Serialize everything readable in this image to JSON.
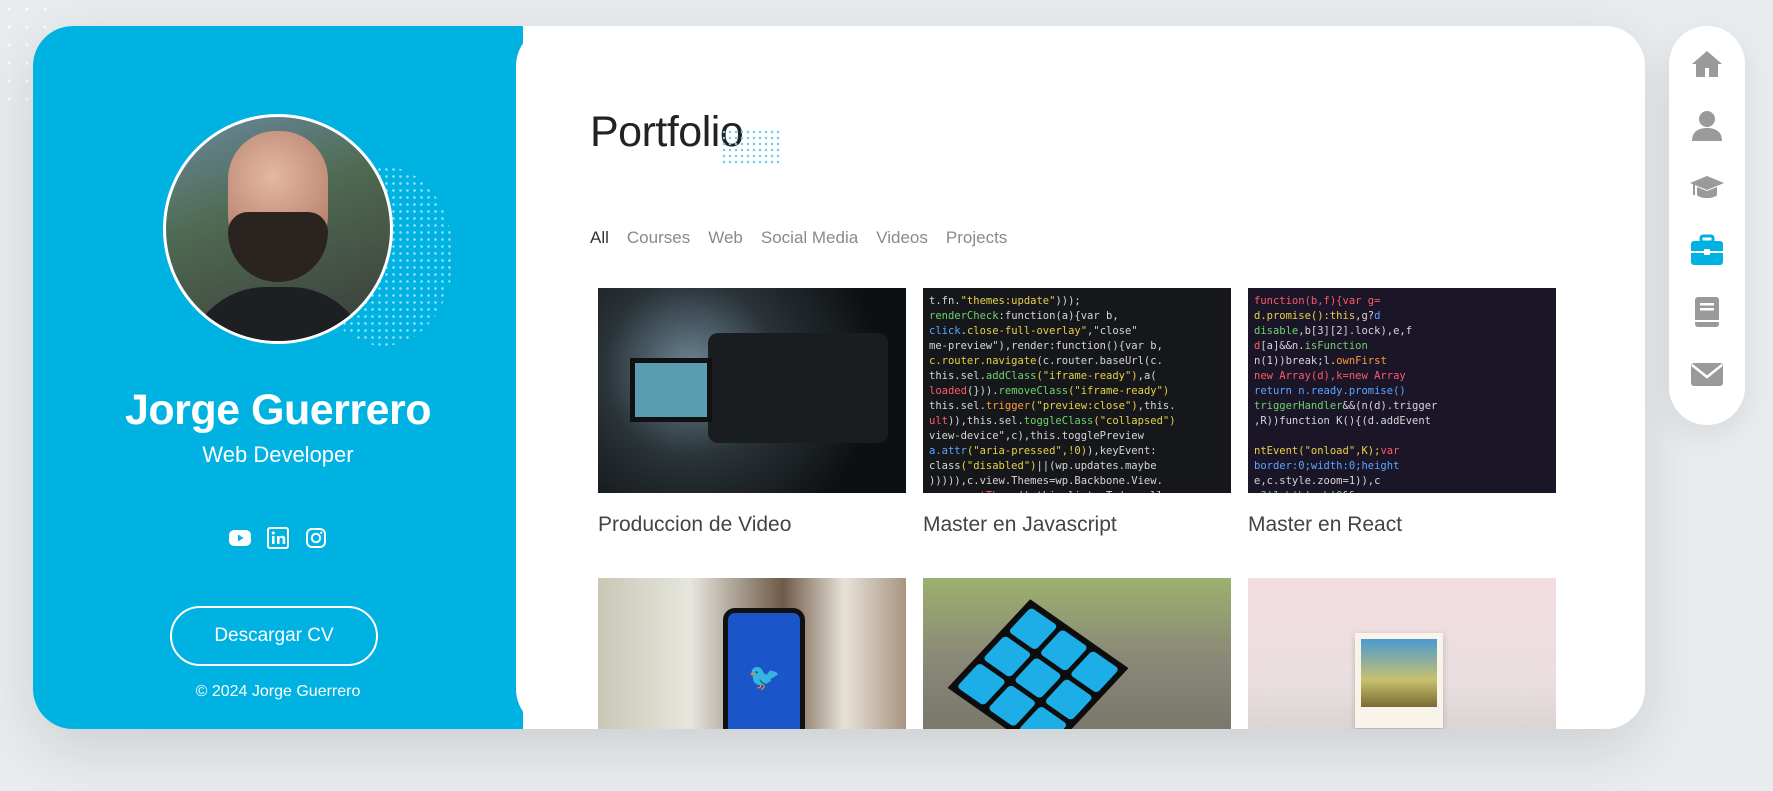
{
  "profile": {
    "name": "Jorge Guerrero",
    "role": "Web Developer",
    "avatar_alt": "Jorge Guerrero",
    "socials": [
      {
        "icon": "youtube-icon"
      },
      {
        "icon": "linkedin-icon"
      },
      {
        "icon": "instagram-icon"
      }
    ],
    "cv_button": "Descargar CV",
    "copyright": "© 2024 Jorge Guerrero"
  },
  "portfolio": {
    "title": "Portfolio",
    "filters": [
      "All",
      "Courses",
      "Web",
      "Social Media",
      "Videos",
      "Projects"
    ],
    "active_filter": "All",
    "items": [
      {
        "title": "Produccion de Video",
        "thumb": "video-camera"
      },
      {
        "title": "Master en Javascript",
        "thumb": "javascript-code"
      },
      {
        "title": "Master en React",
        "thumb": "react-code"
      },
      {
        "title": "",
        "thumb": "twitter-phone"
      },
      {
        "title": "",
        "thumb": "rubiks-cube"
      },
      {
        "title": "",
        "thumb": "polaroid-photo"
      }
    ]
  },
  "nav": {
    "items": [
      {
        "icon": "home-icon",
        "active": false
      },
      {
        "icon": "user-icon",
        "active": false
      },
      {
        "icon": "graduation-cap-icon",
        "active": false
      },
      {
        "icon": "briefcase-icon",
        "active": true
      },
      {
        "icon": "book-icon",
        "active": false
      },
      {
        "icon": "envelope-icon",
        "active": false
      }
    ]
  },
  "colors": {
    "accent": "#00b2e2",
    "nav_inactive": "#9a9a9a",
    "nav_active": "#00b2e2"
  }
}
